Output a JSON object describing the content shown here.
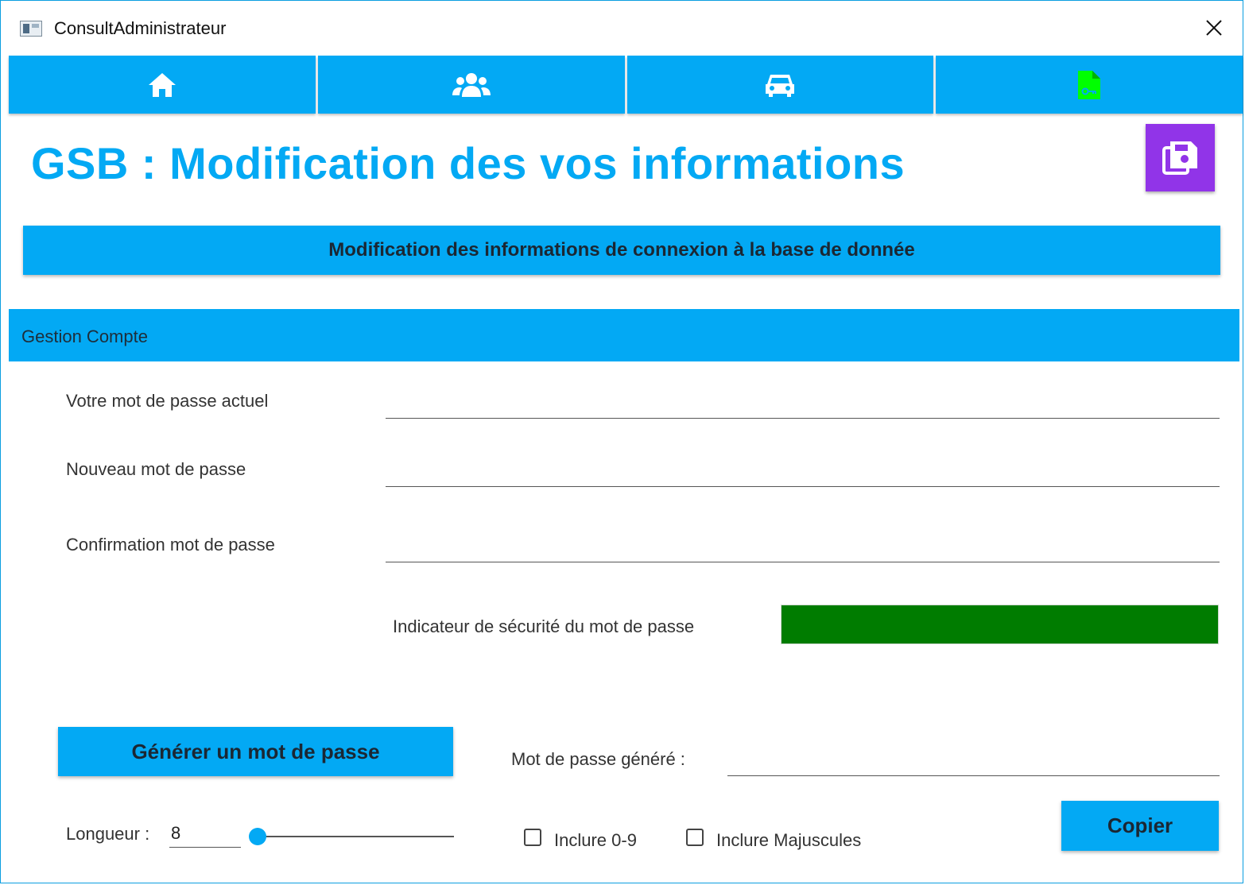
{
  "window": {
    "title": "ConsultAdministrateur",
    "close_label": "✕"
  },
  "nav": {
    "tabs": [
      {
        "icon": "home-icon",
        "color": "#ffffff"
      },
      {
        "icon": "users-icon",
        "color": "#ffffff"
      },
      {
        "icon": "car-icon",
        "color": "#ffffff"
      },
      {
        "icon": "file-key-icon",
        "color": "#00ff00"
      }
    ]
  },
  "header": {
    "title": "GSB : Modification des vos informations",
    "save_icon": "save-icon",
    "save_color": "#9134e8"
  },
  "section_button": {
    "label": "Modification des informations de connexion à la base de donnée"
  },
  "group": {
    "title": "Gestion Compte"
  },
  "form": {
    "current_password_label": "Votre mot de passe actuel",
    "current_password_value": "",
    "new_password_label": "Nouveau mot de passe",
    "new_password_value": "",
    "confirm_password_label": "Confirmation mot de passe",
    "confirm_password_value": "",
    "strength_label": "Indicateur de sécurité du mot de passe",
    "strength_color": "#007c00"
  },
  "generator": {
    "generate_label": "Générer un mot de passe",
    "generated_label": "Mot de passe généré :",
    "generated_value": "",
    "length_label": "Longueur :",
    "length_value": "8",
    "include_digits_label": "Inclure 0-9",
    "include_digits_checked": false,
    "include_upper_label": "Inclure Majuscules",
    "include_upper_checked": false,
    "copy_label": "Copier"
  },
  "colors": {
    "accent": "#03a9f4",
    "save": "#9134e8",
    "strength_ok": "#007c00"
  }
}
